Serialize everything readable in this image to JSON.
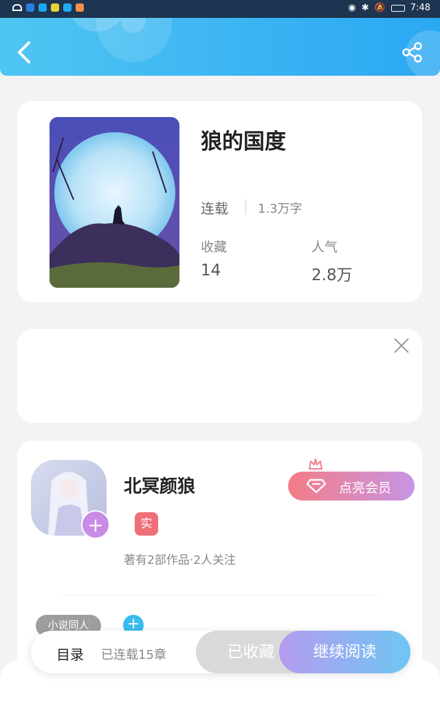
{
  "status_bar": {
    "time": "7:48"
  },
  "book": {
    "title": "狼的国度",
    "status": "连载",
    "word_count": "1.3万字",
    "favorites_label": "收藏",
    "favorites_value": "14",
    "popularity_label": "人气",
    "popularity_value": "2.8万"
  },
  "author": {
    "name": "北冥颜狼",
    "tag": "实",
    "stats": "著有2部作品·2人关注",
    "vip_label": "点亮会员",
    "follow_symbol": "+"
  },
  "chips": {
    "label": "小说同人",
    "add_symbol": "+"
  },
  "bottom_bar": {
    "toc_label": "目录",
    "chapters_label": "已连载15章",
    "collected_label": "已收藏",
    "read_label": "继续阅读"
  },
  "colors": {
    "header": "#3ab3f3",
    "vip_start": "#f47c86",
    "vip_end": "#c795e4"
  },
  "icons": [
    "back-icon",
    "share-icon",
    "close-icon",
    "crown-icon",
    "diamond-icon"
  ]
}
